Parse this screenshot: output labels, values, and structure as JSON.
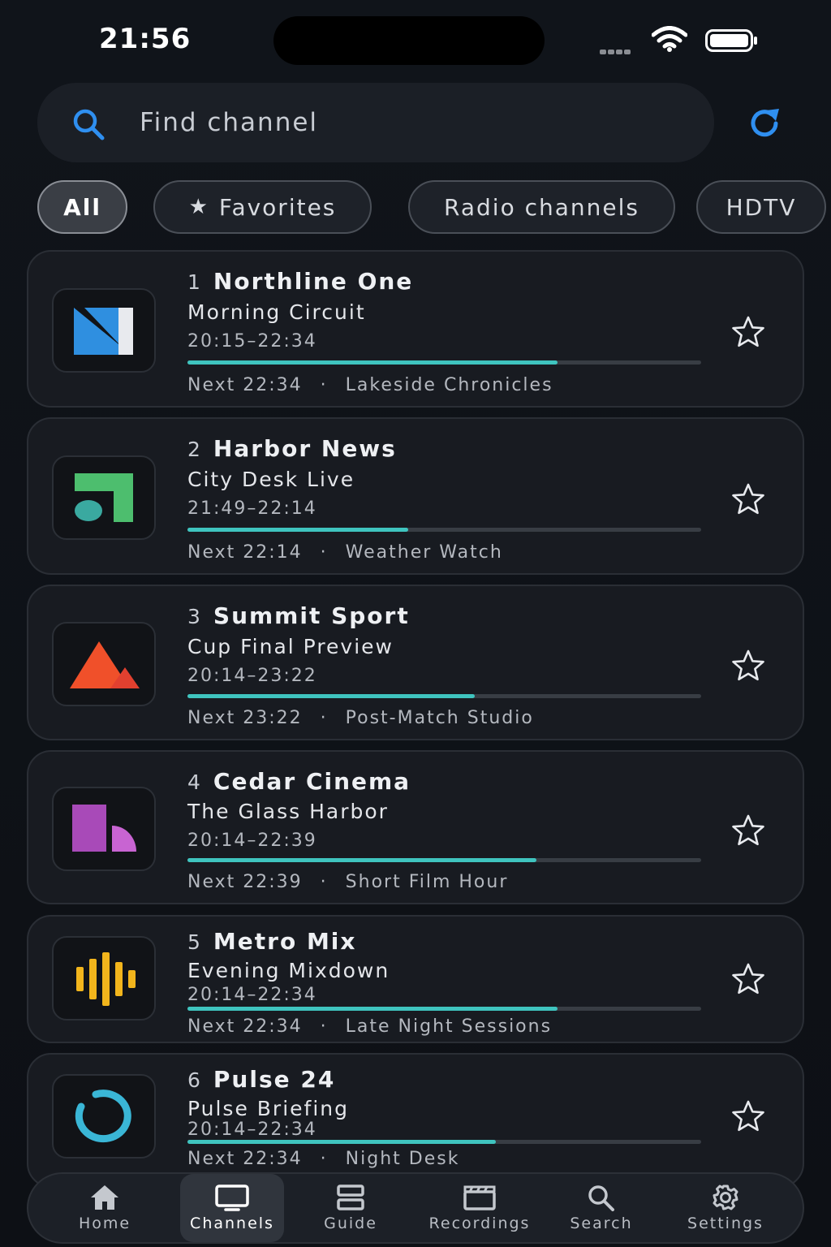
{
  "status_bar": {
    "time": "21:56"
  },
  "search": {
    "placeholder": "Find channel"
  },
  "filters": [
    {
      "label": "All",
      "active": true
    },
    {
      "label": "Favorites",
      "active": false,
      "icon": "star-icon"
    },
    {
      "label": "Radio channels",
      "active": false
    },
    {
      "label": "HDTV",
      "active": false
    }
  ],
  "channels": [
    {
      "number": "1",
      "name": "Northline One",
      "program": "Morning Circuit",
      "time": "20:15–22:34",
      "progress": 0.72,
      "next_time": "Next 22:34",
      "next_title": "Lakeside Chronicles",
      "logo": "northline-logo",
      "logo_colors": [
        "#2f8fe0",
        "#e8eaee"
      ]
    },
    {
      "number": "2",
      "name": "Harbor News",
      "program": "City Desk Live",
      "time": "21:49–22:14",
      "progress": 0.43,
      "next_time": "Next 22:14",
      "next_title": "Weather Watch",
      "logo": "harbor-logo",
      "logo_colors": [
        "#4dbe6e",
        "#3aa9a0"
      ]
    },
    {
      "number": "3",
      "name": "Summit Sport",
      "program": "Cup Final Preview",
      "time": "20:14–23:22",
      "progress": 0.56,
      "next_time": "Next 23:22",
      "next_title": "Post-Match Studio",
      "logo": "summit-logo",
      "logo_colors": [
        "#f0502a",
        "#e2402f"
      ]
    },
    {
      "number": "4",
      "name": "Cedar Cinema",
      "program": "The Glass Harbor",
      "time": "20:14–22:39",
      "progress": 0.68,
      "next_time": "Next 22:39",
      "next_title": "Short Film Hour",
      "logo": "cedar-logo",
      "logo_colors": [
        "#a84ab8",
        "#c864d2"
      ]
    },
    {
      "number": "5",
      "name": "Metro Mix",
      "program": "Evening Mixdown",
      "time": "20:14–22:34",
      "progress": 0.72,
      "next_time": "Next 22:34",
      "next_title": "Late Night Sessions",
      "logo": "metro-logo",
      "logo_colors": [
        "#f2b51c"
      ]
    },
    {
      "number": "6",
      "name": "Pulse 24",
      "program": "Pulse Briefing",
      "time": "20:14–22:34",
      "progress": 0.6,
      "next_time": "Next 22:34",
      "next_title": "Night Desk",
      "logo": "pulse-logo",
      "logo_colors": [
        "#3ab6d6"
      ]
    }
  ],
  "tabs": [
    {
      "label": "Home",
      "icon": "home-icon",
      "active": false
    },
    {
      "label": "Channels",
      "icon": "tv-icon",
      "active": true
    },
    {
      "label": "Guide",
      "icon": "guide-icon",
      "active": false
    },
    {
      "label": "Recordings",
      "icon": "clapper-icon",
      "active": false
    },
    {
      "label": "Search",
      "icon": "search-icon",
      "active": false
    },
    {
      "label": "Settings",
      "icon": "gear-icon",
      "active": false
    }
  ],
  "colors": {
    "accent": "#2f8ff0",
    "progress": "#3fc4bf",
    "background": "#0f1217",
    "card": "#181b21"
  }
}
